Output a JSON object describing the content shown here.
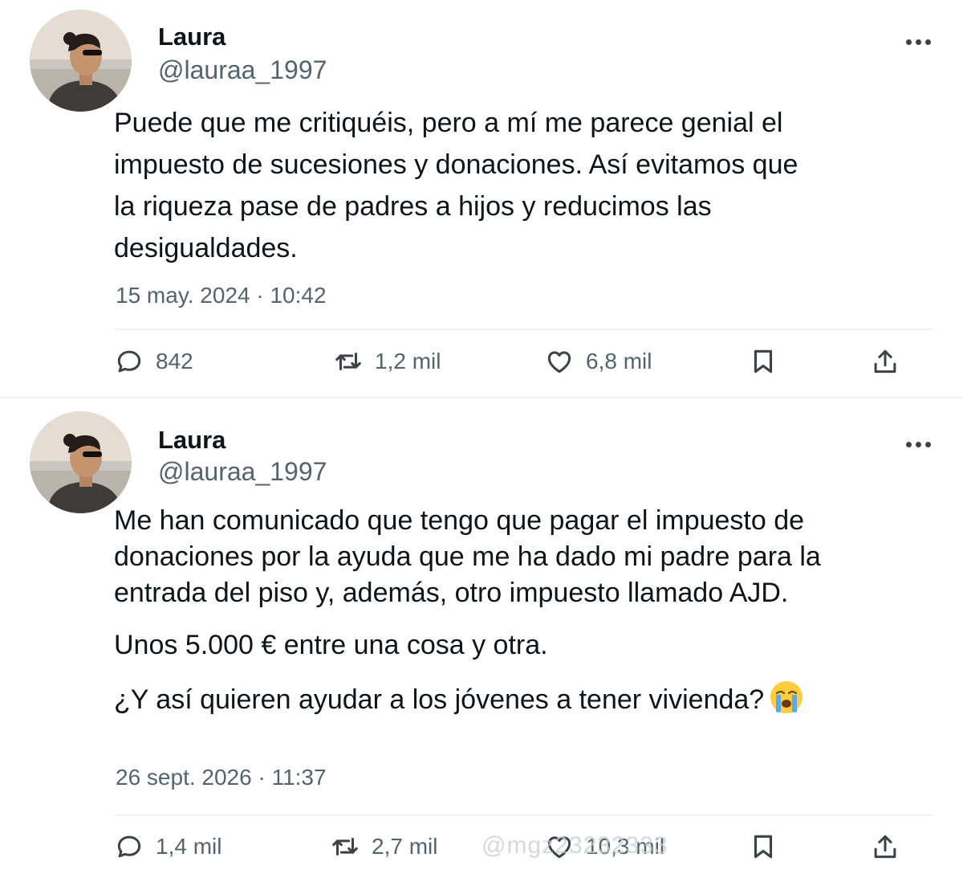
{
  "tweets": [
    {
      "name": "Laura",
      "handle": "@lauraa_1997",
      "paragraphs": [
        "Puede que me critiquéis, pero a mí me parece genial el impuesto de sucesiones y donaciones. Así evitamos que la riqueza pase de padres a hijos y reducimos las desigualdades."
      ],
      "timestamp": "15 may. 2024 · 10:42",
      "stats": {
        "replies": "842",
        "retweets": "1,2 mil",
        "likes": "6,8 mil"
      }
    },
    {
      "name": "Laura",
      "handle": "@lauraa_1997",
      "paragraphs": [
        "Me han comunicado que tengo que pagar el impuesto de donaciones por la ayuda que me ha dado mi padre para la entrada del piso y, además, otro impuesto llamado AJD.",
        "Unos 5.000 € entre una cosa y otra.",
        "¿Y así quieren ayudar a los jóvenes a tener vivienda?"
      ],
      "emoji": "loudly-crying-face",
      "timestamp": "26 sept. 2026 · 11:37",
      "stats": {
        "replies": "1,4 mil",
        "retweets": "2,7 mil",
        "likes": "10,3 mil"
      }
    }
  ],
  "watermark": "@mgz23232333",
  "colors": {
    "text": "#0f1419",
    "secondary": "#536471",
    "divider": "#eff3f4",
    "icon": "#3b4248"
  }
}
